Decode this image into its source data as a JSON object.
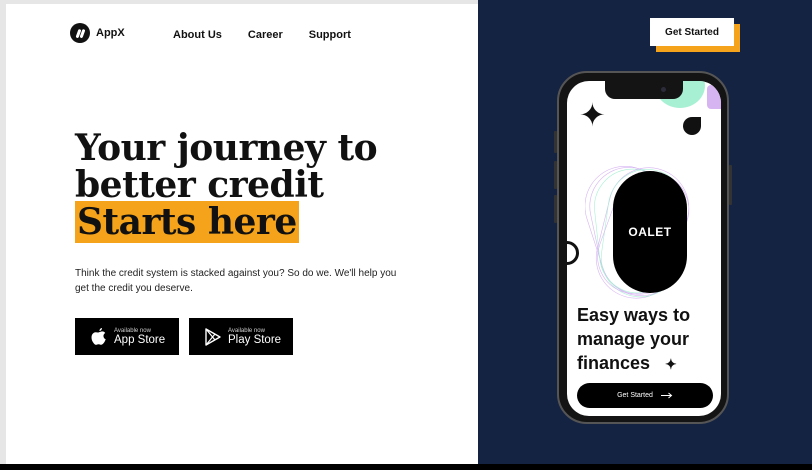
{
  "app": {
    "name": "AppX"
  },
  "nav": {
    "items": [
      {
        "label": "About Us"
      },
      {
        "label": "Career"
      },
      {
        "label": "Support"
      }
    ],
    "cta_label": "Get Started"
  },
  "hero": {
    "title_line1": "Your journey to",
    "title_line2": "better credit",
    "title_highlight": "Starts here",
    "subtitle": "Think the credit system is stacked against you? So do we. We'll help you get the credit you deserve."
  },
  "stores": {
    "app_store": {
      "small": "Available now",
      "label": "App Store",
      "icon": "apple-icon"
    },
    "play_store": {
      "small": "Available now",
      "label": "Play Store",
      "icon": "play-store-icon"
    }
  },
  "phone": {
    "card_label": "OALET",
    "headline_line1": "Easy ways to",
    "headline_line2": "manage your",
    "headline_line3": "finances",
    "cta_label": "Get Started",
    "cta_icon": "arrow-right-icon"
  },
  "colors": {
    "accent": "#f5a31a",
    "navy": "#152342",
    "mint": "#a8f0d4",
    "lavender": "#d6b4f2"
  }
}
